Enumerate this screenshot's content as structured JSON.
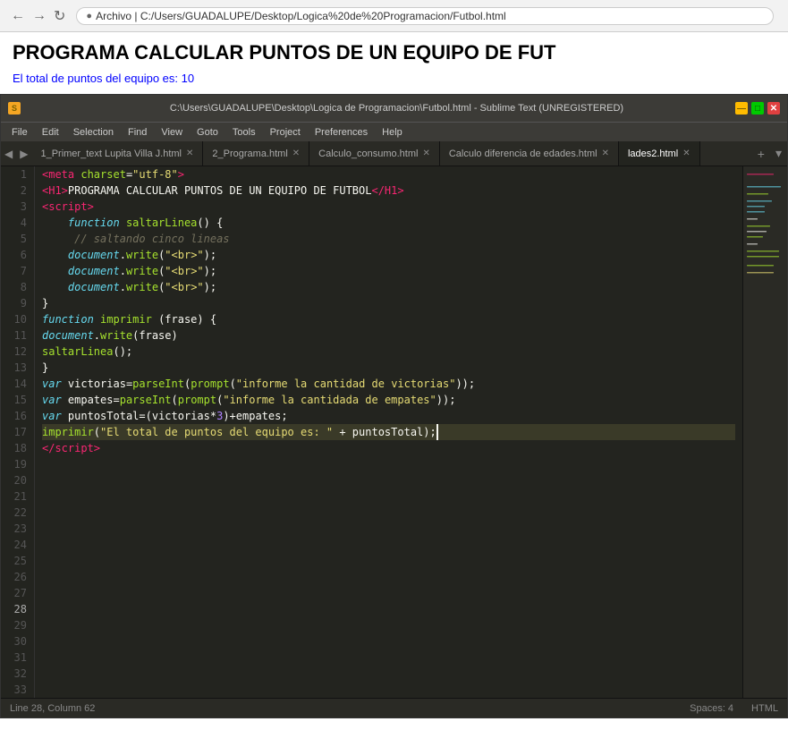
{
  "browser": {
    "address": "Archivo  |  C:/Users/GUADALUPE/Desktop/Logica%20de%20Programacion/Futbol.html"
  },
  "webpage": {
    "title": "PROGRAMA CALCULAR PUNTOS DE UN EQUIPO DE FUT",
    "output": "El total de puntos del equipo es: 10"
  },
  "sublime": {
    "titlebar": "C:\\Users\\GUADALUPE\\Desktop\\Logica de Programacion\\Futbol.html - Sublime Text (UNREGISTERED)",
    "menu_items": [
      "File",
      "Edit",
      "Selection",
      "Find",
      "View",
      "Goto",
      "Tools",
      "Project",
      "Preferences",
      "Help"
    ],
    "tabs": [
      {
        "label": "1_Primer_text Lupita Villa J.html",
        "active": false
      },
      {
        "label": "2_Programa.html",
        "active": false
      },
      {
        "label": "Calculo_consumo.html",
        "active": false
      },
      {
        "label": "Calculo diferencia de edades.html",
        "active": false
      },
      {
        "label": "lades2.html",
        "active": true
      }
    ]
  },
  "statusbar": {
    "left": "Line 28, Column 62",
    "spaces": "Spaces: 4",
    "syntax": "HTML"
  }
}
